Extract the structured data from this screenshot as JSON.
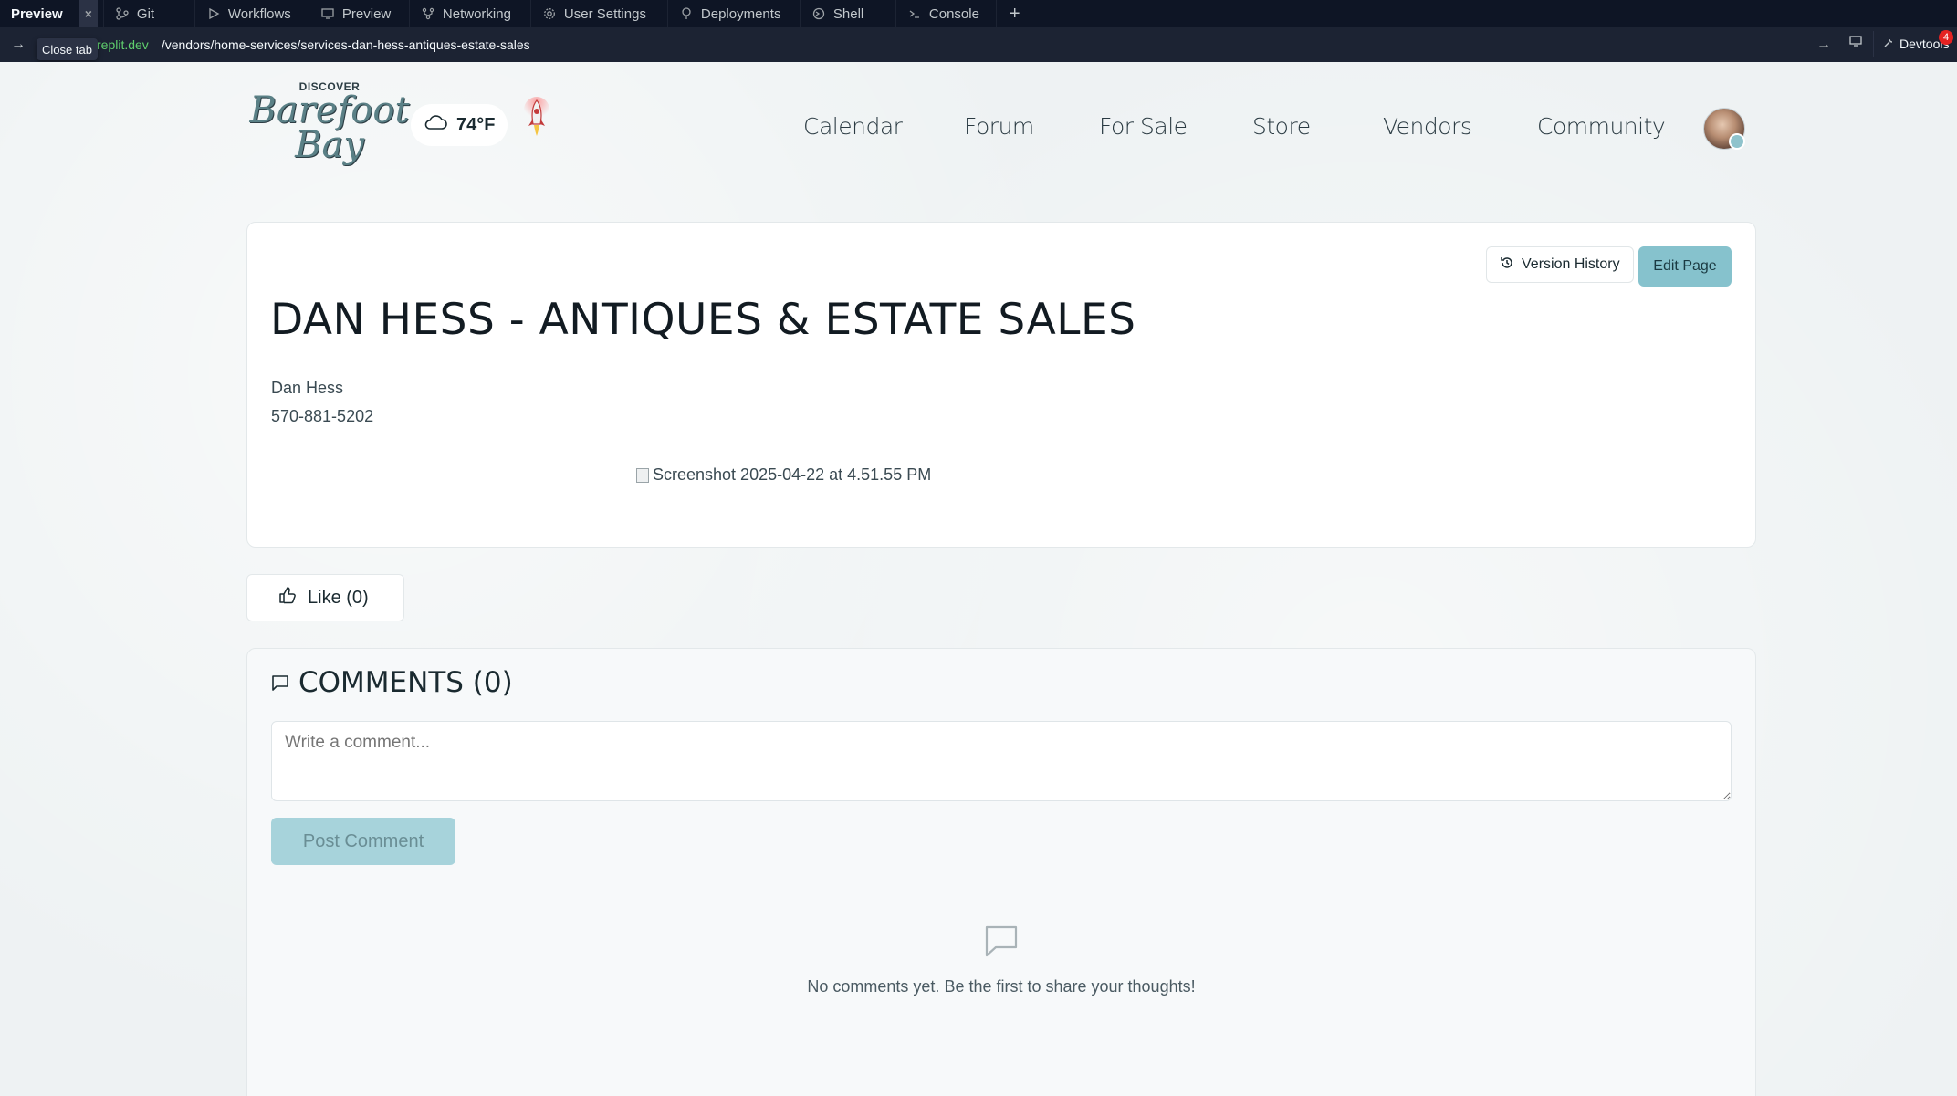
{
  "ide": {
    "tabs": [
      {
        "label": "Preview",
        "icon": "none",
        "active": true
      },
      {
        "label": "Git",
        "icon": "git-icon"
      },
      {
        "label": "Workflows",
        "icon": "play-icon"
      },
      {
        "label": "Preview",
        "icon": "monitor-icon"
      },
      {
        "label": "Networking",
        "icon": "network-icon"
      },
      {
        "label": "User Settings",
        "icon": "gear-icon"
      },
      {
        "label": "Deployments",
        "icon": "deploy-icon"
      },
      {
        "label": "Shell",
        "icon": "shell-icon"
      },
      {
        "label": "Console",
        "icon": "terminal-icon"
      }
    ],
    "close_symbol": "×",
    "add_symbol": "+",
    "tooltip": "Close tab",
    "devtools_label": "Devtools",
    "devtools_badge": "4"
  },
  "url": {
    "domain": "replit.dev",
    "path": "/vendors/home-services/services-dan-hess-antiques-estate-sales"
  },
  "site": {
    "logo_top": "DISCOVER",
    "logo_line1": "Barefoot",
    "logo_line2": "Bay",
    "weather": "74°F",
    "nav": [
      "Calendar",
      "Forum",
      "For Sale",
      "Store",
      "Vendors",
      "Community"
    ]
  },
  "page": {
    "title": "DAN HESS - ANTIQUES & ESTATE SALES",
    "version_history_label": "Version History",
    "edit_label": "Edit Page",
    "vendor_name": "Dan Hess",
    "vendor_phone": "570-881-5202",
    "image_alt": "Screenshot 2025-04-22 at 4.51.55 PM"
  },
  "engagement": {
    "like_label": "Like (0)",
    "comments_title": "COMMENTS (0)",
    "comment_placeholder": "Write a comment...",
    "post_label": "Post Comment",
    "empty_text": "No comments yet. Be the first to share your thoughts!"
  },
  "colors": {
    "ide_bg": "#0e1525",
    "accent": "#86c2cd",
    "url_domain": "#5fce6d"
  }
}
